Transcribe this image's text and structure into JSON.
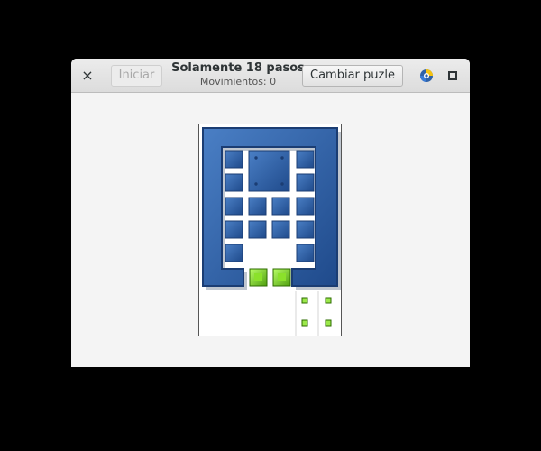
{
  "header": {
    "close_label": "×",
    "start_label": "Iniciar",
    "title": "Solamente 18 pasos",
    "subtitle": "Movimientos: 0",
    "change_label": "Cambiar puzle"
  },
  "icons": {
    "close": "close-icon",
    "app": "app-icon",
    "maximize": "maximize-icon"
  },
  "colors": {
    "wall_blue": "#2f62a8",
    "wall_dark": "#1b3d73",
    "piece_green": "#7ed321",
    "target_green": "#9be84a",
    "board_border": "#555555",
    "background": "#000000"
  },
  "game": {
    "moves": 0,
    "limit_steps": 18
  }
}
